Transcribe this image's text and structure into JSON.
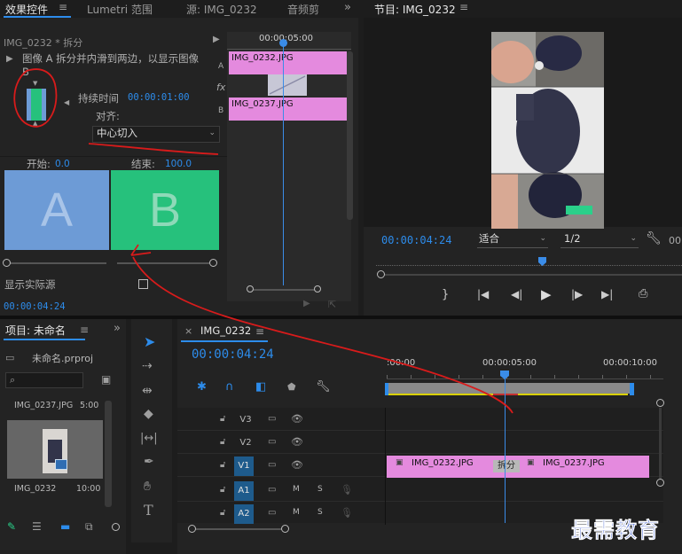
{
  "effect_controls": {
    "tabs": [
      "效果控件",
      "Lumetri 范围",
      "源: IMG_0232",
      "音频剪"
    ],
    "clip_title": "IMG_0232 * 拆分",
    "description": "图像 A 拆分并内滑到两边，以显示图像 B",
    "duration_label": "持续时间",
    "duration_value": "00:00:01:00",
    "align_label": "对齐:",
    "align_value": "中心切入",
    "start_label": "开始:",
    "start_value": "0.0",
    "end_label": "结束:",
    "end_value": "100.0",
    "letter_a": "A",
    "letter_b": "B",
    "show_actual_label": "显示实际源",
    "timecode": "00:00:04:24",
    "mini_timeline": {
      "time": "00:00:05:00",
      "track_a_label": "A",
      "track_b_label": "B",
      "fx_label": "fx",
      "clip_a": "IMG_0232.JPG",
      "clip_b": "IMG_0237.JPG"
    }
  },
  "program_monitor": {
    "title": "节目: IMG_0232",
    "timecode": "00:00:04:24",
    "fit_value": "适合",
    "quality_value": "1/2",
    "trailing_timecode": "00"
  },
  "project_panel": {
    "title": "项目: 未命名",
    "file_name": "未命名.prproj",
    "items": [
      {
        "name": "IMG_0237.JPG",
        "duration": "5:00"
      },
      {
        "name": "IMG_0232",
        "duration": "10:00"
      }
    ]
  },
  "timeline": {
    "sequence_name": "IMG_0232",
    "timecode": "00:00:04:24",
    "ruler": [
      ":00:00",
      "00:00:05:00",
      "00:00:10:00"
    ],
    "tracks": [
      {
        "name": "V3"
      },
      {
        "name": "V2"
      },
      {
        "name": "V1"
      },
      {
        "name": "A1",
        "m": "M",
        "s": "S"
      },
      {
        "name": "A2",
        "m": "M",
        "s": "S"
      }
    ],
    "clip1": "IMG_0232.JPG",
    "transition": "拆分",
    "clip2": "IMG_0237.JPG"
  },
  "watermark": "最需教育",
  "colors": {
    "accent_blue": "#2d8ceb",
    "clip_pink": "#e48ade",
    "a_block": "#6d9bd6",
    "b_block": "#26c17c",
    "annotation_red": "#d81b1b"
  }
}
